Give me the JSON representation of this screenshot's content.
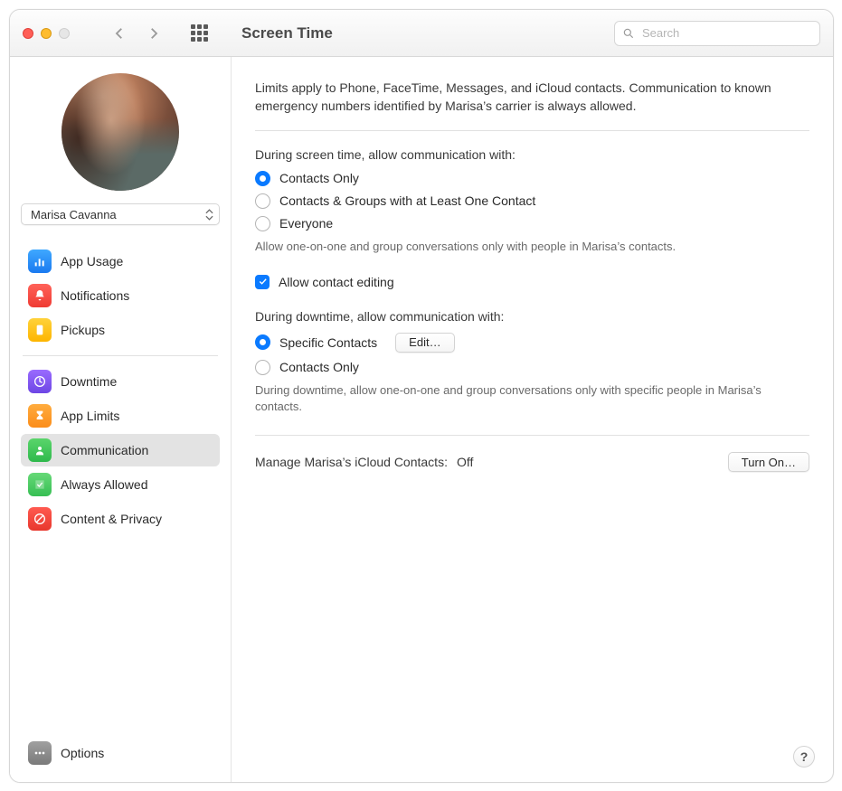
{
  "window": {
    "title": "Screen Time"
  },
  "search": {
    "placeholder": "Search"
  },
  "user": {
    "name": "Marisa Cavanna"
  },
  "sidebar": {
    "items": [
      {
        "label": "App Usage"
      },
      {
        "label": "Notifications"
      },
      {
        "label": "Pickups"
      },
      {
        "label": "Downtime"
      },
      {
        "label": "App Limits"
      },
      {
        "label": "Communication"
      },
      {
        "label": "Always Allowed"
      },
      {
        "label": "Content & Privacy"
      }
    ],
    "options_label": "Options"
  },
  "main": {
    "desc": "Limits apply to Phone, FaceTime, Messages, and iCloud contacts. Communication to known emergency numbers identified by Marisa’s carrier is always allowed.",
    "screenTime": {
      "title": "During screen time, allow communication with:",
      "opt1": "Contacts Only",
      "opt2": "Contacts & Groups with at Least One Contact",
      "opt3": "Everyone",
      "hint": "Allow one-on-one and group conversations only with people in Marisa’s contacts."
    },
    "allowEditing": "Allow contact editing",
    "downtime": {
      "title": "During downtime, allow communication with:",
      "opt1": "Specific Contacts",
      "edit": "Edit…",
      "opt2": "Contacts Only",
      "hint": "During downtime, allow one-on-one and group conversations only with specific people in Marisa’s contacts."
    },
    "manage": {
      "label": "Manage Marisa’s iCloud Contacts:",
      "status": "Off",
      "button": "Turn On…"
    }
  }
}
